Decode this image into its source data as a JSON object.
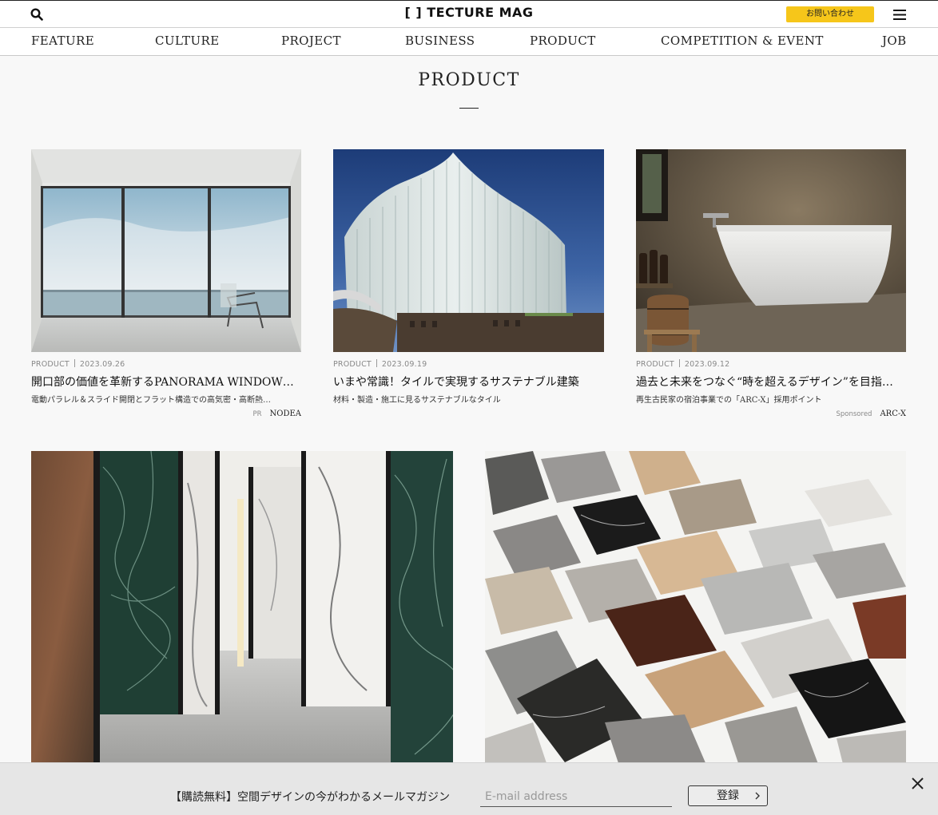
{
  "header": {
    "logo_text": "[ ] TECTURE MAG",
    "contact_label": "お問い合わせ"
  },
  "nav": {
    "items": [
      "FEATURE",
      "CULTURE",
      "PROJECT",
      "BUSINESS",
      "PRODUCT",
      "COMPETITION & EVENT",
      "JOB"
    ]
  },
  "page": {
    "title": "PRODUCT"
  },
  "cards": [
    {
      "category": "PRODUCT",
      "date": "2023.09.26",
      "title": "開口部の価値を革新するPANORAMA WINDOW…",
      "subtitle": "電動パラレル＆スライド開閉とフラット構造での高気密・高断熱…",
      "sponsor_tag": "PR",
      "sponsor": "NODEA"
    },
    {
      "category": "PRODUCT",
      "date": "2023.09.19",
      "title": "いまや常識！タイルで実現するサステナブル建築",
      "subtitle": "材料・製造・施工に見るサステナブルなタイル",
      "sponsor_tag": "",
      "sponsor": ""
    },
    {
      "category": "PRODUCT",
      "date": "2023.09.12",
      "title": "過去と未来をつなぐ“時を超えるデザイン”を目指…",
      "subtitle": "再生古民家の宿泊事業での「ARC-X」採用ポイント",
      "sponsor_tag": "Sponsored",
      "sponsor": "ARC-X"
    }
  ],
  "newsletter": {
    "text": "【購読無料】空間デザインの今がわかるメールマガジン",
    "placeholder": "E-mail address",
    "button_label": "登録"
  }
}
